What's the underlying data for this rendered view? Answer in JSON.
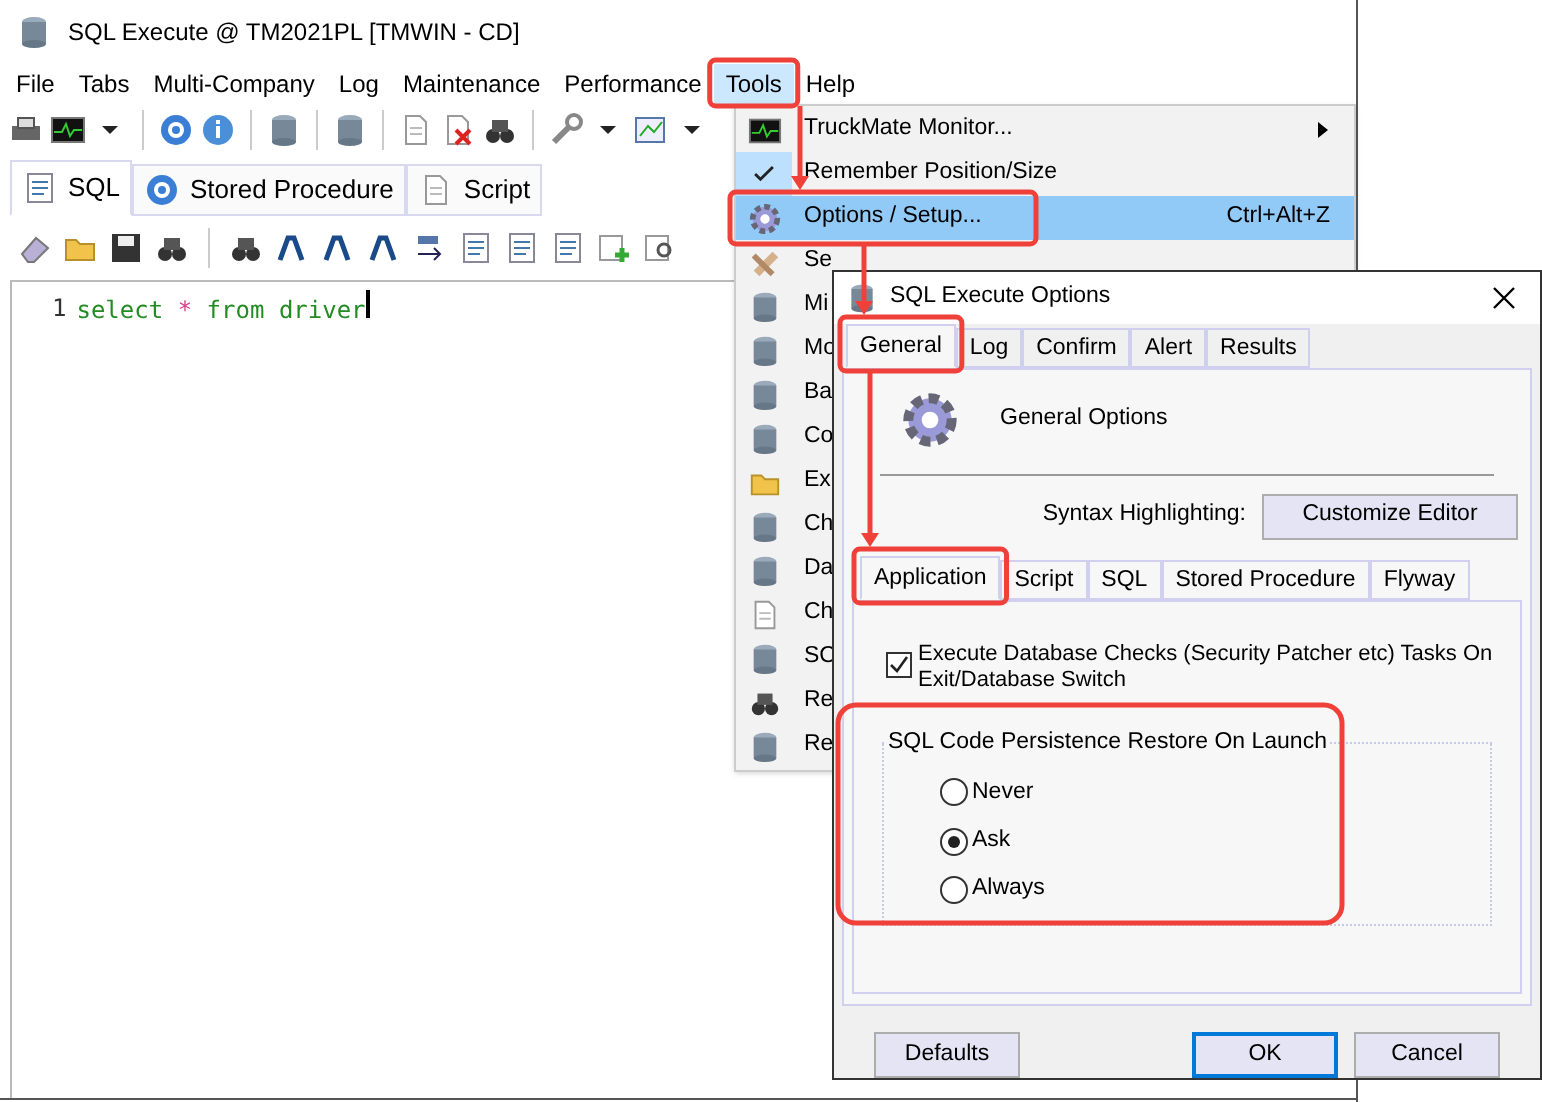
{
  "window": {
    "title": "SQL Execute @ TM2021PL [TMWIN - CD]"
  },
  "menu_bar": [
    {
      "label": "File",
      "selected": false
    },
    {
      "label": "Tabs",
      "selected": false
    },
    {
      "label": "Multi-Company",
      "selected": false
    },
    {
      "label": "Log",
      "selected": false
    },
    {
      "label": "Maintenance",
      "selected": false
    },
    {
      "label": "Performance",
      "selected": false
    },
    {
      "label": "Tools",
      "selected": true
    },
    {
      "label": "Help",
      "selected": false
    }
  ],
  "tabs": [
    {
      "label": "SQL",
      "selected": true
    },
    {
      "label": "Stored Procedure",
      "selected": false
    },
    {
      "label": "Script",
      "selected": false
    }
  ],
  "editor": {
    "line_number": "1",
    "tokens": [
      {
        "text": "select",
        "kind": "keyword"
      },
      {
        "text": "*",
        "kind": "operator"
      },
      {
        "text": "from",
        "kind": "keyword"
      },
      {
        "text": "driver",
        "kind": "identifier"
      }
    ]
  },
  "tools_menu": [
    {
      "label": "TruckMate Monitor...",
      "submenu": true,
      "checked": false,
      "selected": false
    },
    {
      "label": "Remember Position/Size",
      "checked": true,
      "selected": false
    },
    {
      "label": "Options / Setup...",
      "shortcut": "Ctrl+Alt+Z",
      "checked": false,
      "selected": true
    },
    {
      "label": "Se",
      "checked": false,
      "selected": false
    },
    {
      "label": "Mi",
      "checked": false,
      "selected": false
    },
    {
      "label": "Mo",
      "checked": false,
      "selected": false
    },
    {
      "label": "Ba",
      "checked": false,
      "selected": false
    },
    {
      "label": "Co",
      "checked": false,
      "selected": false
    },
    {
      "label": "Ex",
      "checked": false,
      "selected": false
    },
    {
      "label": "Ch",
      "checked": false,
      "selected": false
    },
    {
      "label": "Da",
      "checked": false,
      "selected": false
    },
    {
      "label": "Ch",
      "checked": false,
      "selected": false
    },
    {
      "label": "SC",
      "checked": false,
      "selected": false
    },
    {
      "label": "Re",
      "checked": false,
      "selected": false
    },
    {
      "label": "Re",
      "checked": false,
      "selected": false
    }
  ],
  "dialog": {
    "title": "SQL Execute Options",
    "tabs": [
      {
        "label": "General",
        "selected": true
      },
      {
        "label": "Log",
        "selected": false
      },
      {
        "label": "Confirm",
        "selected": false
      },
      {
        "label": "Alert",
        "selected": false
      },
      {
        "label": "Results",
        "selected": false
      }
    ],
    "header": "General Options",
    "syntax_label": "Syntax Highlighting:",
    "customize_button": "Customize Editor",
    "inner_tabs": [
      {
        "label": "Application",
        "selected": true
      },
      {
        "label": "Script",
        "selected": false
      },
      {
        "label": "SQL",
        "selected": false
      },
      {
        "label": "Stored Procedure",
        "selected": false
      },
      {
        "label": "Flyway",
        "selected": false
      }
    ],
    "checkbox": {
      "label": "Execute Database Checks (Security Patcher etc) Tasks On Exit/Database Switch",
      "checked": true
    },
    "group": {
      "title": "SQL Code Persistence Restore On Launch",
      "options": [
        {
          "label": "Never",
          "selected": false
        },
        {
          "label": "Ask",
          "selected": true
        },
        {
          "label": "Always",
          "selected": false
        }
      ]
    },
    "buttons": [
      {
        "label": "Defaults",
        "default": false
      },
      {
        "label": "OK",
        "default": true
      },
      {
        "label": "Cancel",
        "default": false
      }
    ]
  }
}
